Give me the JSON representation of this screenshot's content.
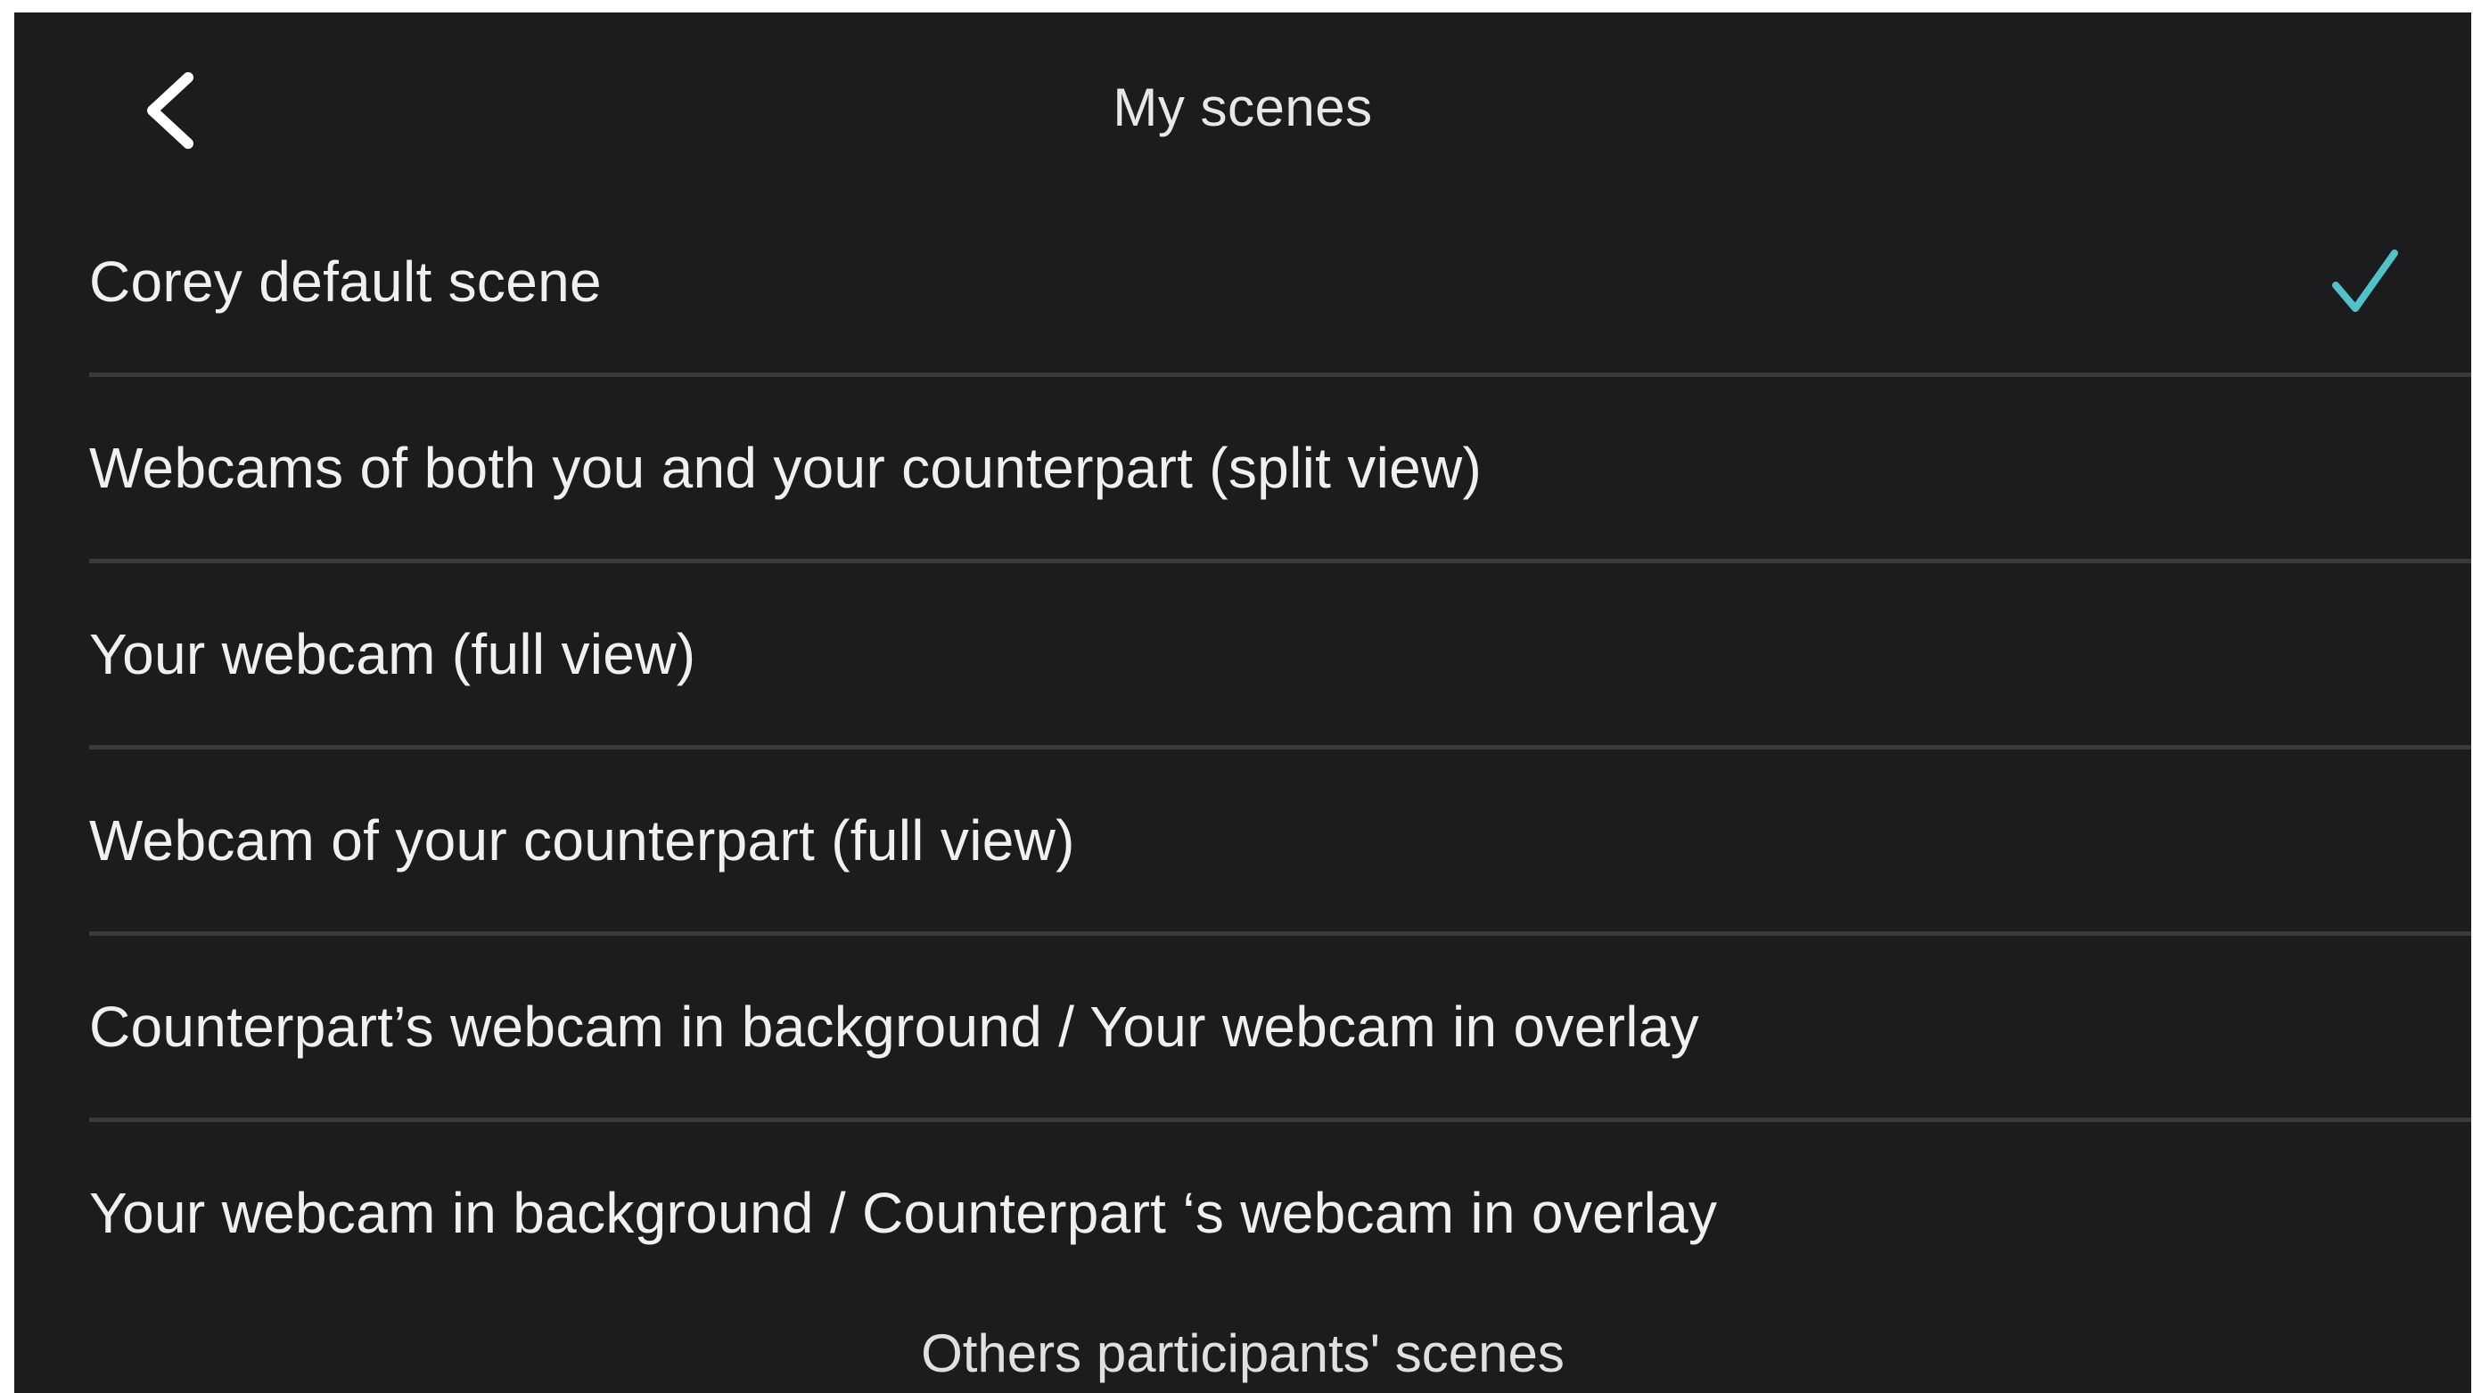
{
  "header": {
    "title": "My scenes",
    "back_icon": "chevron-left-icon"
  },
  "scenes": [
    {
      "label": "Corey  default scene",
      "selected": true
    },
    {
      "label": "Webcams of both you and your counterpart (split view)",
      "selected": false
    },
    {
      "label": "Your webcam (full view)",
      "selected": false
    },
    {
      "label": "Webcam of your counterpart (full view)",
      "selected": false
    },
    {
      "label": "Counterpart’s webcam in background / Your webcam in overlay",
      "selected": false
    },
    {
      "label": "Your webcam in background / Counterpart ‘s webcam in overlay",
      "selected": false
    }
  ],
  "others_section": {
    "title": "Others participants' scenes"
  },
  "colors": {
    "background": "#1c1c1e",
    "text": "#f0f0f0",
    "divider": "#3a3a3c",
    "accent": "#4fc3c9"
  },
  "icons": {
    "selected": "checkmark-icon"
  }
}
